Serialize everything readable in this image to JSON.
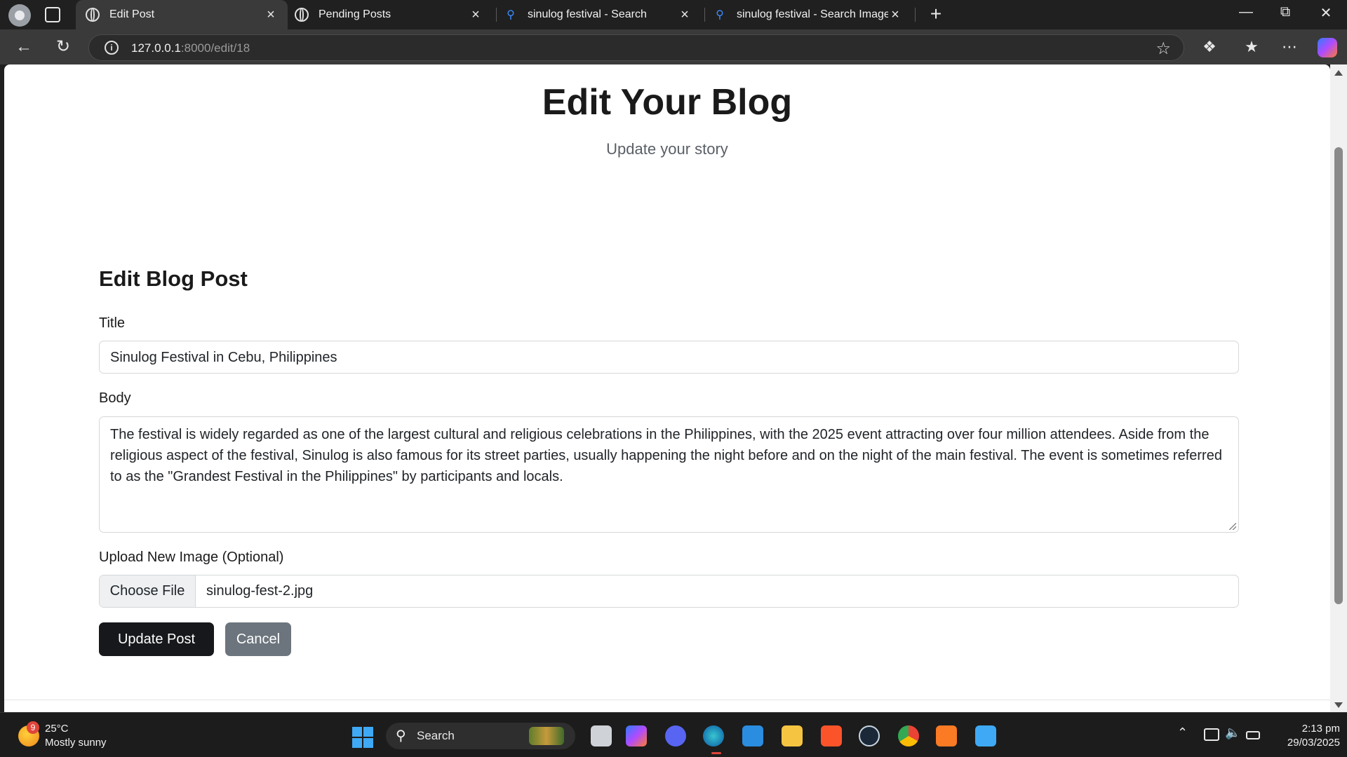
{
  "browser": {
    "tabs": [
      {
        "label": "Edit Post",
        "icon": "globe-icon",
        "active": true
      },
      {
        "label": "Pending Posts",
        "icon": "globe-icon",
        "active": false
      },
      {
        "label": "sinulog festival - Search",
        "icon": "search-icon",
        "active": false
      },
      {
        "label": "sinulog festival - Search Images",
        "icon": "search-icon",
        "active": false
      }
    ],
    "url_host": "127.0.0.1",
    "url_rest": ":8000/edit/18"
  },
  "page": {
    "hero_title": "Edit Your Blog",
    "hero_subtitle": "Update your story",
    "form_heading": "Edit Blog Post",
    "title_label": "Title",
    "title_value": "Sinulog Festival in Cebu, Philippines",
    "body_label": "Body",
    "body_value": "The festival is widely regarded as one of the largest cultural and religious celebrations in the Philippines, with the 2025 event attracting over four million attendees. Aside from the religious aspect of the festival, Sinulog is also famous for its street parties, usually happening the night before and on the night of the main festival. The event is sometimes referred to as the \"Grandest Festival in the Philippines\" by participants and locals.",
    "image_label": "Upload New Image (Optional)",
    "choose_file_label": "Choose File",
    "file_name": "sinulog-fest-2.jpg",
    "update_button": "Update Post",
    "cancel_button": "Cancel"
  },
  "taskbar": {
    "weather_badge": "9",
    "weather_temp": "25°C",
    "weather_desc": "Mostly sunny",
    "search_label": "Search",
    "time": "2:13 pm",
    "date": "29/03/2025"
  },
  "colors": {
    "primary_button": "#16181b",
    "cancel_button": "#6c757d",
    "browser_chrome": "#202020"
  }
}
